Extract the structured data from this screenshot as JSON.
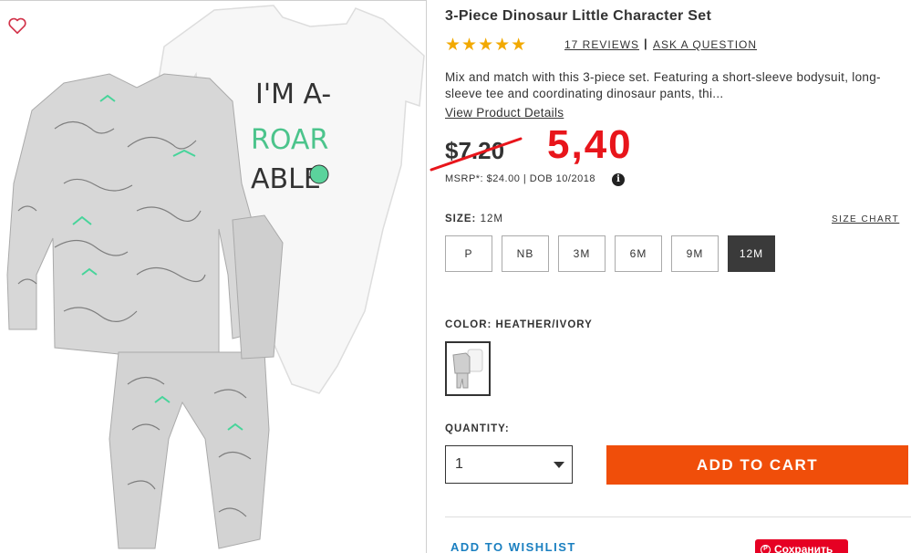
{
  "product": {
    "title": "3-Piece Dinosaur Little Character Set",
    "rating_stars": "★★★★★",
    "reviews_link": "17 REVIEWS",
    "separator": "|",
    "ask_question_link": "ASK A QUESTION",
    "description": "Mix and match with this 3-piece set. Featuring a short-sleeve bodysuit, long-sleeve tee and coordinating dinosaur pants, thi...",
    "view_details_link": "View Product Details",
    "old_price": "$7.20",
    "new_price_annotation": "5,40",
    "msrp_text": "MSRP*: $24.00 | DOB 10/2018",
    "info_icon_glyph": "i",
    "bodysuit_print": [
      "I'M A-",
      "ROAR",
      "ABLE"
    ]
  },
  "size": {
    "label": "SIZE:",
    "selected_value": "12M",
    "chart_link": "SIZE CHART",
    "options": [
      "P",
      "NB",
      "3M",
      "6M",
      "9M",
      "12M"
    ]
  },
  "color": {
    "label": "COLOR: HEATHER/IVORY"
  },
  "quantity": {
    "label": "QUANTITY:",
    "value": "1"
  },
  "actions": {
    "add_to_cart": "ADD TO CART",
    "add_to_wishlist": "ADD TO WISHLIST",
    "pinterest_save": "Сохранить",
    "pinterest_glyph": "P"
  },
  "colors": {
    "accent_orange": "#f04e0a",
    "price_annotation_red": "#e8151b",
    "star_gold": "#f2a900",
    "link_blue": "#1a7fc0",
    "selected_size_bg": "#3a3a3a",
    "pinterest_red": "#e60023"
  },
  "icons": {
    "wishlist_heart": "heart-outline-icon",
    "info": "info-icon",
    "dropdown": "caret-down-icon"
  }
}
